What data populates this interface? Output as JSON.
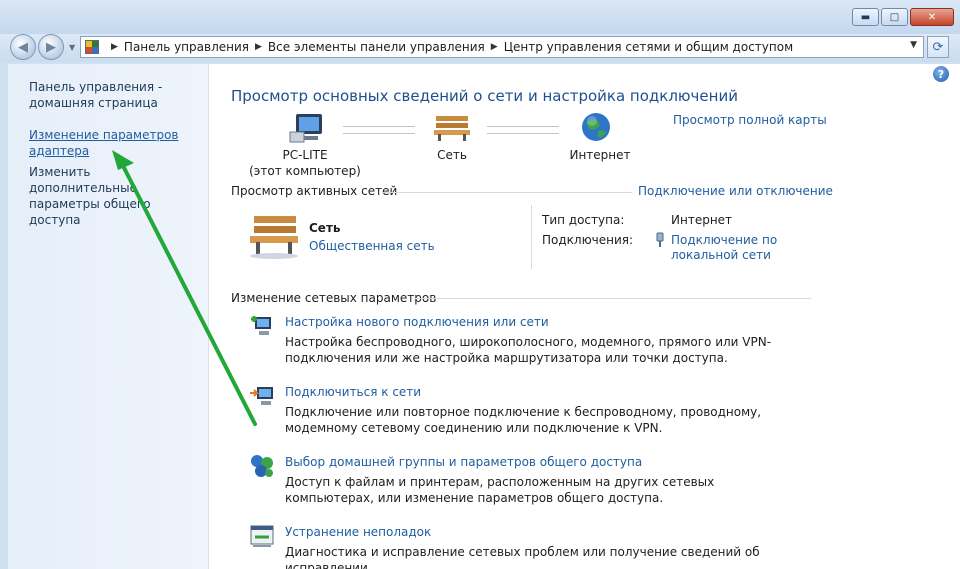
{
  "window": {
    "controls": {
      "minimize": "▬",
      "maximize": "□",
      "close": "✕"
    }
  },
  "navbar": {
    "back_glyph": "◀",
    "forward_glyph": "▶",
    "breadcrumbs": [
      "Панель управления",
      "Все элементы панели управления",
      "Центр управления сетями и общим доступом"
    ],
    "refresh_glyph": "⟳"
  },
  "sidebar": {
    "home_link": "Панель управления - домашняя страница",
    "adapter_link": "Изменение параметров адаптера",
    "sharing_link": "Изменить дополнительные параметры общего доступа"
  },
  "main": {
    "help_glyph": "?",
    "title": "Просмотр основных сведений о сети и настройка подключений",
    "full_map_link": "Просмотр полной карты",
    "map": {
      "computer_name": "PC-LITE",
      "computer_sub": "(этот компьютер)",
      "network": "Сеть",
      "internet": "Интернет"
    },
    "active_networks_heading": "Просмотр активных сетей",
    "connect_disconnect_link": "Подключение или отключение",
    "active_network": {
      "name": "Сеть",
      "type": "Общественная сеть",
      "access_type_label": "Тип доступа:",
      "access_type_value": "Интернет",
      "connections_label": "Подключения:",
      "connection_link": "Подключение по локальной сети"
    },
    "change_settings_heading": "Изменение сетевых параметров",
    "tasks": [
      {
        "link": "Настройка нового подключения или сети",
        "desc": "Настройка беспроводного, широкополосного, модемного, прямого или VPN-подключения или же настройка маршрутизатора или точки доступа."
      },
      {
        "link": "Подключиться к сети",
        "desc": "Подключение или повторное подключение к беспроводному, проводному, модемному сетевому соединению или подключение к VPN."
      },
      {
        "link": "Выбор домашней группы и параметров общего доступа",
        "desc": "Доступ к файлам и принтерам, расположенным на других сетевых компьютерах, или изменение параметров общего доступа."
      },
      {
        "link": "Устранение неполадок",
        "desc": "Диагностика и исправление сетевых проблем или получение сведений об исправлении."
      }
    ]
  },
  "annotation": {
    "arrow_color": "#22a838"
  }
}
